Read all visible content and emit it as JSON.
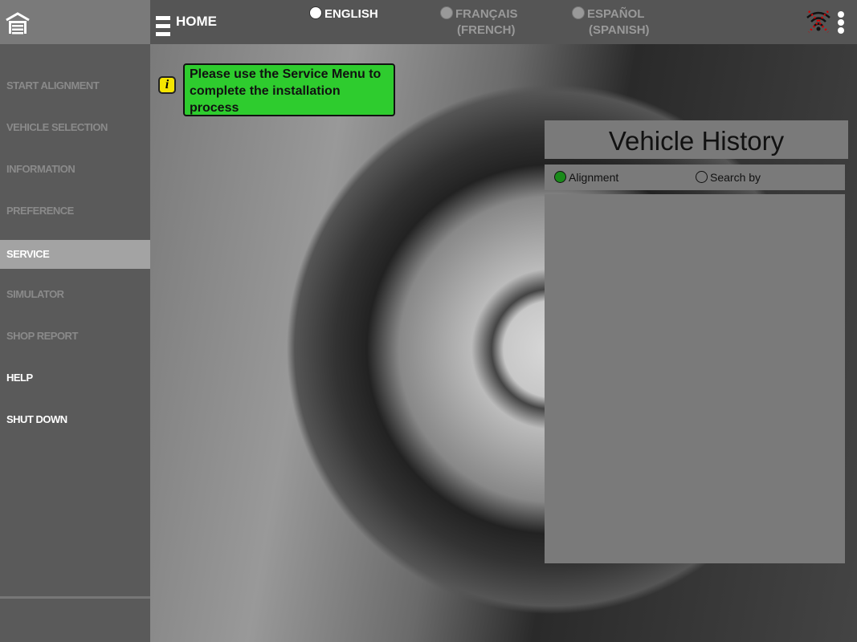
{
  "header": {
    "home_label": "HOME",
    "languages": [
      {
        "label": "ENGLISH",
        "sub": "",
        "selected": true
      },
      {
        "label": "FRANÇAIS",
        "sub": "(FRENCH)",
        "selected": false
      },
      {
        "label": "ESPAÑOL",
        "sub": "(SPANISH)",
        "selected": false
      }
    ]
  },
  "sidebar": {
    "items": [
      {
        "label": "START ALIGNMENT"
      },
      {
        "label": "VEHICLE SELECTION"
      },
      {
        "label": "INFORMATION"
      },
      {
        "label": "PREFERENCE"
      },
      {
        "label": "SERVICE"
      },
      {
        "label": "SIMULATOR"
      },
      {
        "label": "SHOP REPORT"
      },
      {
        "label": "HELP"
      },
      {
        "label": "SHUT DOWN"
      }
    ]
  },
  "notice": {
    "text": "Please use the Service Menu to complete the installation process"
  },
  "vehicle_history": {
    "title": "Vehicle History",
    "options": [
      {
        "label": "Alignment",
        "selected": true
      },
      {
        "label": "Search by",
        "selected": false
      }
    ]
  },
  "colors": {
    "notice_bg": "#2ecc2e",
    "selected_radio": "#1a8a1a",
    "wifi_error": "#d00000"
  }
}
